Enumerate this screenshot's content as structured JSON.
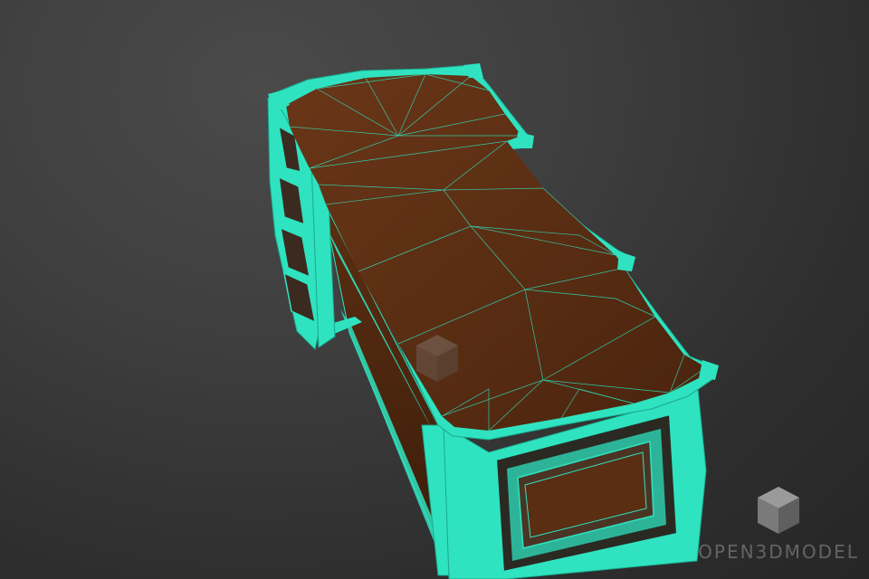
{
  "watermark": {
    "brand_text": "OPEN3DMODEL",
    "logo_icon": "cube-icon"
  },
  "colors": {
    "wire": "#2fe3c0",
    "wood": "#5a2f14",
    "wood_dark": "#3c1d0b",
    "background": "#3b3b3b"
  }
}
